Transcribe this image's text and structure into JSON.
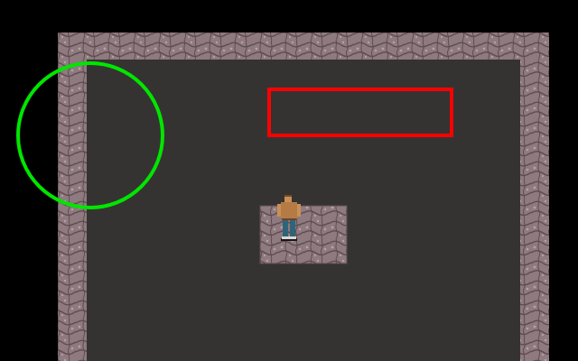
{
  "game": {
    "background_color": "#000000",
    "floor_color": "#353332",
    "wall_base_color": "#8e7a7f",
    "wall_light_color": "#b4a2a5",
    "wall_dark_color": "#5f4c51",
    "character": {
      "skin_color": "#c98f55",
      "shirt_color": "#b57b45",
      "pants_color": "#2f6478",
      "hair_color": "#7a4a25"
    }
  },
  "overlays": {
    "red_box_color": "#ff0000",
    "green_circle_color": "#00e600"
  }
}
